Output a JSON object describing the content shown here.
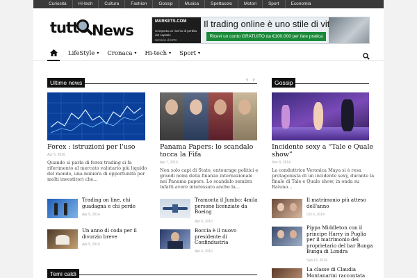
{
  "topbar": {
    "items": [
      "Curiosità",
      "Hi-tech",
      "Cultura",
      "Fashion",
      "Gossip",
      "Musica",
      "Spettacolo",
      "Motori",
      "Sport",
      "Economia"
    ]
  },
  "header": {
    "logo_left": "tutto",
    "logo_right": "News",
    "banner": {
      "brand": "MARKETS.COM",
      "brand_sub": "Comporta un rischio di perdita del capitale",
      "brand_note": "Servizio di CFD",
      "headline": "Il trading online è uno stile di vita",
      "cta": "Ricevi un conto GRATUITO da €100.000 per fare pratica"
    }
  },
  "nav": {
    "items": [
      "LifeStyle",
      "Cronaca",
      "Hi-tech",
      "Sport"
    ]
  },
  "sections": {
    "ultime": "Ultime news",
    "gossip": "Gossip",
    "temi": "Temi caldi"
  },
  "ultime": {
    "main1": {
      "title": "Forex : istruzioni per l'uso",
      "date": "Apr 5, 2016",
      "excerpt": "Quando si parla di forex trading si fa riferimento al mercato valutario più liquido del mondo, una miniera di opportunità per molti investitori che..."
    },
    "main2": {
      "title": "Panama Papers: lo scandalo tocca la Fifa",
      "date": "Apr 7, 2016",
      "excerpt": "Non solo capi di Stato, entourage politici e grandi nomi della finanza internazionale nei Panama papers. Lo scandalo sembra infatti avere interessato anche la..."
    },
    "small": [
      {
        "title": "Trading on line, chi guadagna e chi perde",
        "date": "Apr 5, 2016"
      },
      {
        "title": "Un anno di coda per il divorzio breve",
        "date": "Apr 5, 2016"
      },
      {
        "title": "Tramonta il Jumbo: 4mila persone licenziate da Boeing",
        "date": "Apr 6, 2016"
      },
      {
        "title": "Boccia è il nuovo presidente di Confindustria",
        "date": "Apr 4, 2016"
      }
    ]
  },
  "gossip": {
    "main": {
      "title": "Incidente sexy a “Tale e Quale show”",
      "date": "Nov 8, 2014",
      "excerpt": "La conduttrice Veronica Maya si è resa protagonista di un incidente sexy, durante la finale di Tale e Quale show, in onda su Raiuno..."
    },
    "small": [
      {
        "title": "Il matrimonio più atteso dell'anno",
        "date": "Oct 6, 2014"
      },
      {
        "title": "Pippa Middleton con il principe Harry in Puglia per il matrimonio del proprietario del bar Bunga Bunga di Londra",
        "date": "Sep 16, 2014"
      },
      {
        "title": "La classe di Claudia Montanarini raccontata"
      }
    ]
  }
}
